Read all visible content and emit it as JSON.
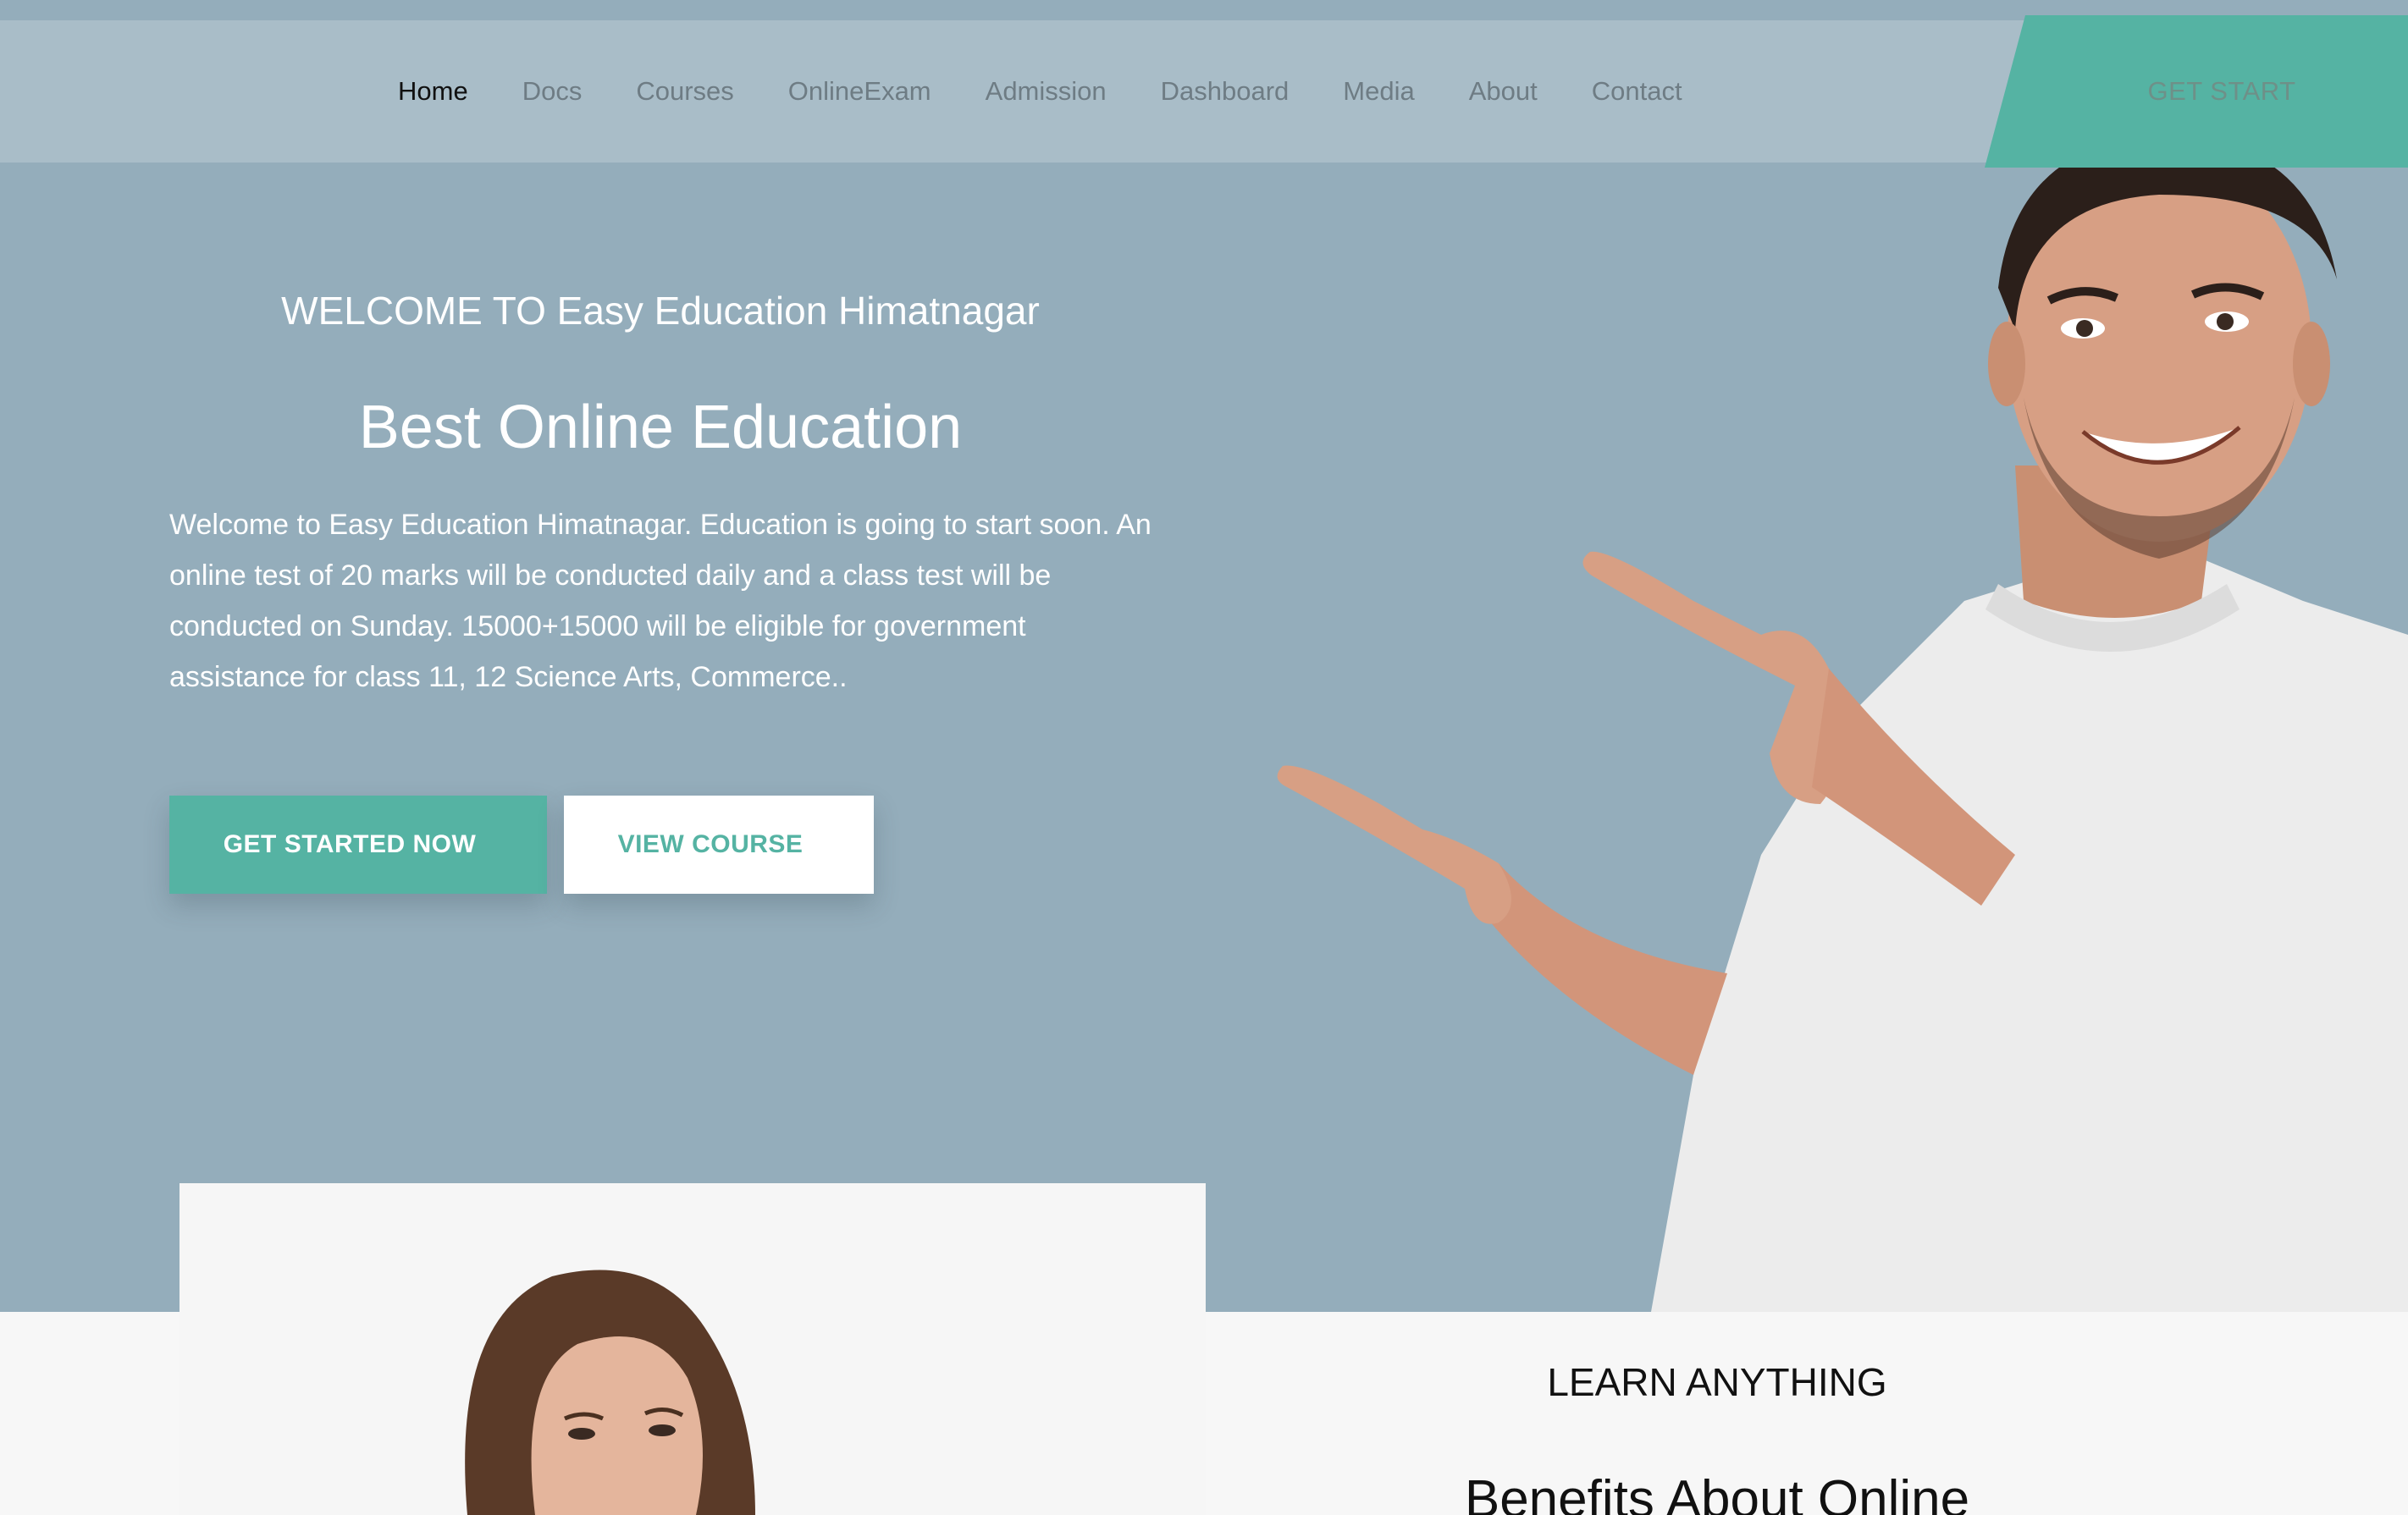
{
  "nav": {
    "items": [
      {
        "label": "Home",
        "active": true
      },
      {
        "label": "Docs"
      },
      {
        "label": "Courses"
      },
      {
        "label": "OnlineExam"
      },
      {
        "label": "Admission"
      },
      {
        "label": "Dashboard"
      },
      {
        "label": "Media"
      },
      {
        "label": "About"
      },
      {
        "label": "Contact"
      }
    ],
    "cta_label": "GET START"
  },
  "hero": {
    "welcome": "WELCOME TO Easy Education Himatnagar",
    "headline": "Best Online Education",
    "description": "Welcome to Easy Education Himatnagar. Education is going to start soon. An online test of 20 marks will be conducted daily and a class test will be conducted on Sunday. 15000+15000 will be eligible for government assistance for class 11, 12 Science Arts, Commerce..",
    "primary_button": "GET STARTED NOW",
    "secondary_button": "VIEW COURSE"
  },
  "section": {
    "eyebrow": "LEARN ANYTHING",
    "title": "Benefits About Online"
  },
  "colors": {
    "hero_bg": "#94adbb",
    "navbar_bg": "#a9bdc8",
    "accent": "#55b3a3",
    "lower_bg": "#f7f7f7"
  }
}
